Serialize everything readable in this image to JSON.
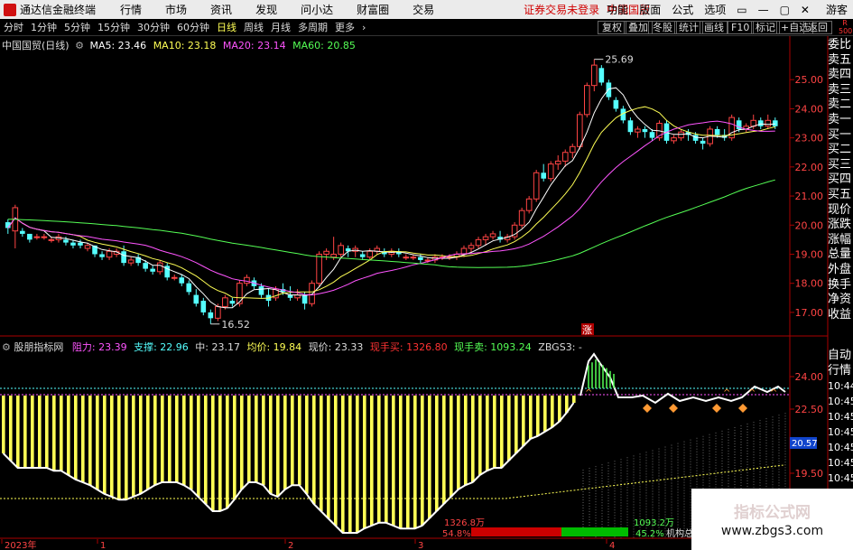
{
  "app": {
    "title": "通达信金融终端",
    "menu": [
      "行情",
      "市场",
      "资讯",
      "发现",
      "问小达",
      "财富圈",
      "交易"
    ],
    "notice": "证券交易未登录",
    "stock_title": "中国国贸",
    "right_menu": [
      "功能",
      "版面",
      "公式",
      "选项"
    ],
    "guest": "游客",
    "window_buttons": [
      "▭",
      "—",
      "▢",
      "✕"
    ]
  },
  "periods": {
    "items": [
      "分时",
      "1分钟",
      "5分钟",
      "15分钟",
      "30分钟",
      "60分钟",
      "日线",
      "周线",
      "月线",
      "多周期",
      "更多"
    ],
    "active": "日线",
    "tools": [
      "复权",
      "叠加",
      "冬股",
      "统计",
      "画线",
      "F10",
      "标记",
      "+自选",
      "返回"
    ],
    "corner_badge": "R 500"
  },
  "main_chart": {
    "name": "中国国贸(日线)",
    "ma": [
      {
        "label": "MA5: 23.46",
        "color": "#ffffff"
      },
      {
        "label": "MA10: 23.18",
        "color": "#ffff55"
      },
      {
        "label": "MA20: 23.14",
        "color": "#ff55ff"
      },
      {
        "label": "MA60: 20.85",
        "color": "#55ff55"
      }
    ],
    "high_label": "25.69",
    "low_label": "16.52",
    "up_marker": "涨"
  },
  "indicator": {
    "name": "股朋指标网",
    "fields": [
      {
        "label": "阻力: 23.39",
        "color": "#ff55ff"
      },
      {
        "label": "支撑: 22.96",
        "color": "#55ffff"
      },
      {
        "label": "中: 23.17",
        "color": "#dddddd"
      },
      {
        "label": "均价: 19.84",
        "color": "#ffff55"
      },
      {
        "label": "现价: 23.33",
        "color": "#dddddd"
      },
      {
        "label": "现手买: 1326.80",
        "color": "#ff3333"
      },
      {
        "label": "现手卖: 1093.24",
        "color": "#55ff55"
      },
      {
        "label": "ZBGS3: -",
        "color": "#dddddd"
      }
    ],
    "price_badge": "20.57",
    "buy_vol": "1326.8万",
    "sell_vol": "1093.2万",
    "buy_pct": "54.8%",
    "sell_pct": "45.2%",
    "inst_label": "机构总"
  },
  "chart_data": [
    {
      "type": "candlestick",
      "title": "中国国贸(日线)",
      "ylim": [
        16.5,
        26.0
      ],
      "y_ticks": [
        "25.00",
        "24.00",
        "23.00",
        "22.00",
        "21.00",
        "20.00",
        "19.00",
        "18.00",
        "17.00"
      ],
      "x_ticks": [
        "2023年",
        "1",
        "2",
        "3",
        "4"
      ],
      "ohlc": [
        [
          20.1,
          20.2,
          19.7,
          19.9
        ],
        [
          19.8,
          20.7,
          19.2,
          20.6
        ],
        [
          19.8,
          19.9,
          19.6,
          19.7
        ],
        [
          19.7,
          19.7,
          19.4,
          19.5
        ],
        [
          19.6,
          19.7,
          19.5,
          19.6
        ],
        [
          19.6,
          19.7,
          19.5,
          19.6
        ],
        [
          19.5,
          19.6,
          19.4,
          19.5
        ],
        [
          19.5,
          19.7,
          19.4,
          19.6
        ],
        [
          19.5,
          19.6,
          19.3,
          19.4
        ],
        [
          19.4,
          19.5,
          19.2,
          19.3
        ],
        [
          19.4,
          19.5,
          19.2,
          19.3
        ],
        [
          19.2,
          19.4,
          19.1,
          19.3
        ],
        [
          19.3,
          19.3,
          18.9,
          19.0
        ],
        [
          19.0,
          19.1,
          18.8,
          18.9
        ],
        [
          18.9,
          19.2,
          18.8,
          19.1
        ],
        [
          19.0,
          19.2,
          18.9,
          19.1
        ],
        [
          19.1,
          19.3,
          18.6,
          18.7
        ],
        [
          18.7,
          18.9,
          18.6,
          18.8
        ],
        [
          18.9,
          19.0,
          18.6,
          18.7
        ],
        [
          18.7,
          18.8,
          18.4,
          18.5
        ],
        [
          18.5,
          18.6,
          18.3,
          18.4
        ],
        [
          18.4,
          18.8,
          18.3,
          18.7
        ],
        [
          18.6,
          18.7,
          18.1,
          18.2
        ],
        [
          18.2,
          18.3,
          18.1,
          18.2
        ],
        [
          18.2,
          18.3,
          17.9,
          18.0
        ],
        [
          18.0,
          18.1,
          17.6,
          17.7
        ],
        [
          17.6,
          17.8,
          17.2,
          17.3
        ],
        [
          17.4,
          17.5,
          16.9,
          17.0
        ],
        [
          17.0,
          17.1,
          16.6,
          16.8
        ],
        [
          16.8,
          17.3,
          16.7,
          17.2
        ],
        [
          17.2,
          17.6,
          17.1,
          17.5
        ],
        [
          17.4,
          17.5,
          17.2,
          17.3
        ],
        [
          17.3,
          18.1,
          17.2,
          18.0
        ],
        [
          18.0,
          18.3,
          17.9,
          18.2
        ],
        [
          18.1,
          18.2,
          17.8,
          17.9
        ],
        [
          17.9,
          18.0,
          17.5,
          17.6
        ],
        [
          17.6,
          17.8,
          17.2,
          17.4
        ],
        [
          17.5,
          17.9,
          17.4,
          17.8
        ],
        [
          17.8,
          18.0,
          17.6,
          17.7
        ],
        [
          17.6,
          17.9,
          17.4,
          17.5
        ],
        [
          17.5,
          17.8,
          17.4,
          17.6
        ],
        [
          17.6,
          17.7,
          17.1,
          17.3
        ],
        [
          17.3,
          18.1,
          17.2,
          18.0
        ],
        [
          18.0,
          19.1,
          17.9,
          19.0
        ],
        [
          19.0,
          19.2,
          18.8,
          19.1
        ],
        [
          18.9,
          19.6,
          18.8,
          19.0
        ],
        [
          19.0,
          19.4,
          18.9,
          19.3
        ],
        [
          19.2,
          19.3,
          18.9,
          19.1
        ],
        [
          19.1,
          19.3,
          18.9,
          19.2
        ],
        [
          19.0,
          19.1,
          18.8,
          18.9
        ],
        [
          18.9,
          19.2,
          18.8,
          19.1
        ],
        [
          19.1,
          19.3,
          19.0,
          19.2
        ],
        [
          19.1,
          19.2,
          18.9,
          19.0
        ],
        [
          19.0,
          19.2,
          18.9,
          19.1
        ],
        [
          19.1,
          19.2,
          18.9,
          19.0
        ],
        [
          18.9,
          19.0,
          18.8,
          18.9
        ],
        [
          18.9,
          19.0,
          18.8,
          18.9
        ],
        [
          18.9,
          19.0,
          18.7,
          18.8
        ],
        [
          18.8,
          18.9,
          18.7,
          18.8
        ],
        [
          18.8,
          19.0,
          18.7,
          18.9
        ],
        [
          18.9,
          19.0,
          18.8,
          18.9
        ],
        [
          18.9,
          19.0,
          18.8,
          18.9
        ],
        [
          18.9,
          19.1,
          18.8,
          19.0
        ],
        [
          19.0,
          19.3,
          18.9,
          19.2
        ],
        [
          19.2,
          19.4,
          19.0,
          19.3
        ],
        [
          19.3,
          19.6,
          19.2,
          19.5
        ],
        [
          19.5,
          19.7,
          19.3,
          19.6
        ],
        [
          19.6,
          19.8,
          19.5,
          19.7
        ],
        [
          19.6,
          19.8,
          19.4,
          19.5
        ],
        [
          19.5,
          19.7,
          19.4,
          19.6
        ],
        [
          19.6,
          20.1,
          19.5,
          20.0
        ],
        [
          20.0,
          20.6,
          19.9,
          20.5
        ],
        [
          20.5,
          21.0,
          20.4,
          20.9
        ],
        [
          20.9,
          21.9,
          20.8,
          21.8
        ],
        [
          21.8,
          22.1,
          21.5,
          21.6
        ],
        [
          21.6,
          22.2,
          21.5,
          22.1
        ],
        [
          22.1,
          22.4,
          21.9,
          22.2
        ],
        [
          22.2,
          22.6,
          22.0,
          22.5
        ],
        [
          22.5,
          22.8,
          22.3,
          22.7
        ],
        [
          22.7,
          23.9,
          22.6,
          23.8
        ],
        [
          23.8,
          24.9,
          23.7,
          24.8
        ],
        [
          24.8,
          25.7,
          24.6,
          25.5
        ],
        [
          25.4,
          25.5,
          24.8,
          24.9
        ],
        [
          24.9,
          25.0,
          24.3,
          24.4
        ],
        [
          24.3,
          24.4,
          23.9,
          24.0
        ],
        [
          24.0,
          24.1,
          23.5,
          23.6
        ],
        [
          23.6,
          23.7,
          23.1,
          23.2
        ],
        [
          23.2,
          23.4,
          23.0,
          23.3
        ],
        [
          23.3,
          23.4,
          23.0,
          23.2
        ],
        [
          23.2,
          23.3,
          22.9,
          23.0
        ],
        [
          23.0,
          23.6,
          22.9,
          23.5
        ],
        [
          23.5,
          23.6,
          22.8,
          22.9
        ],
        [
          22.9,
          23.1,
          22.8,
          23.0
        ],
        [
          23.0,
          23.3,
          22.9,
          23.2
        ],
        [
          23.2,
          23.3,
          22.9,
          23.1
        ],
        [
          23.1,
          23.2,
          22.8,
          22.9
        ],
        [
          22.9,
          23.0,
          22.6,
          22.8
        ],
        [
          22.8,
          23.4,
          22.7,
          23.3
        ],
        [
          23.3,
          23.4,
          23.0,
          23.1
        ],
        [
          23.1,
          23.3,
          22.9,
          23.0
        ],
        [
          23.0,
          23.8,
          22.9,
          23.7
        ],
        [
          23.6,
          23.7,
          23.2,
          23.3
        ],
        [
          23.3,
          23.5,
          23.2,
          23.4
        ],
        [
          23.4,
          23.8,
          23.3,
          23.6
        ],
        [
          23.6,
          23.7,
          23.3,
          23.4
        ],
        [
          23.4,
          23.8,
          23.3,
          23.6
        ],
        [
          23.6,
          23.7,
          23.3,
          23.4
        ]
      ],
      "series": [
        {
          "name": "MA5",
          "color": "#ffffff"
        },
        {
          "name": "MA10",
          "color": "#ffff55"
        },
        {
          "name": "MA20",
          "color": "#ff55ff"
        },
        {
          "name": "MA60",
          "color": "#55ff55"
        }
      ]
    },
    {
      "type": "bar",
      "title": "股朋指标网",
      "y_ticks": [
        "24.00",
        "22.50",
        "20.57",
        "19.50"
      ],
      "values": [
        0.4,
        0.45,
        0.5,
        0.5,
        0.5,
        0.5,
        0.5,
        0.52,
        0.52,
        0.55,
        0.58,
        0.6,
        0.62,
        0.65,
        0.68,
        0.7,
        0.72,
        0.72,
        0.7,
        0.68,
        0.65,
        0.62,
        0.6,
        0.6,
        0.6,
        0.62,
        0.65,
        0.7,
        0.75,
        0.8,
        0.8,
        0.78,
        0.72,
        0.65,
        0.6,
        0.6,
        0.62,
        0.68,
        0.7,
        0.65,
        0.62,
        0.62,
        0.68,
        0.75,
        0.8,
        0.85,
        0.9,
        0.95,
        0.95,
        0.95,
        0.92,
        0.9,
        0.88,
        0.88,
        0.9,
        0.92,
        0.92,
        0.92,
        0.9,
        0.85,
        0.8,
        0.75,
        0.7,
        0.65,
        0.62,
        0.6,
        0.55,
        0.52,
        0.5,
        0.5,
        0.45,
        0.4,
        0.35,
        0.3,
        0.28,
        0.25,
        0.22,
        0.18,
        0.12,
        0.05
      ]
    }
  ]
}
